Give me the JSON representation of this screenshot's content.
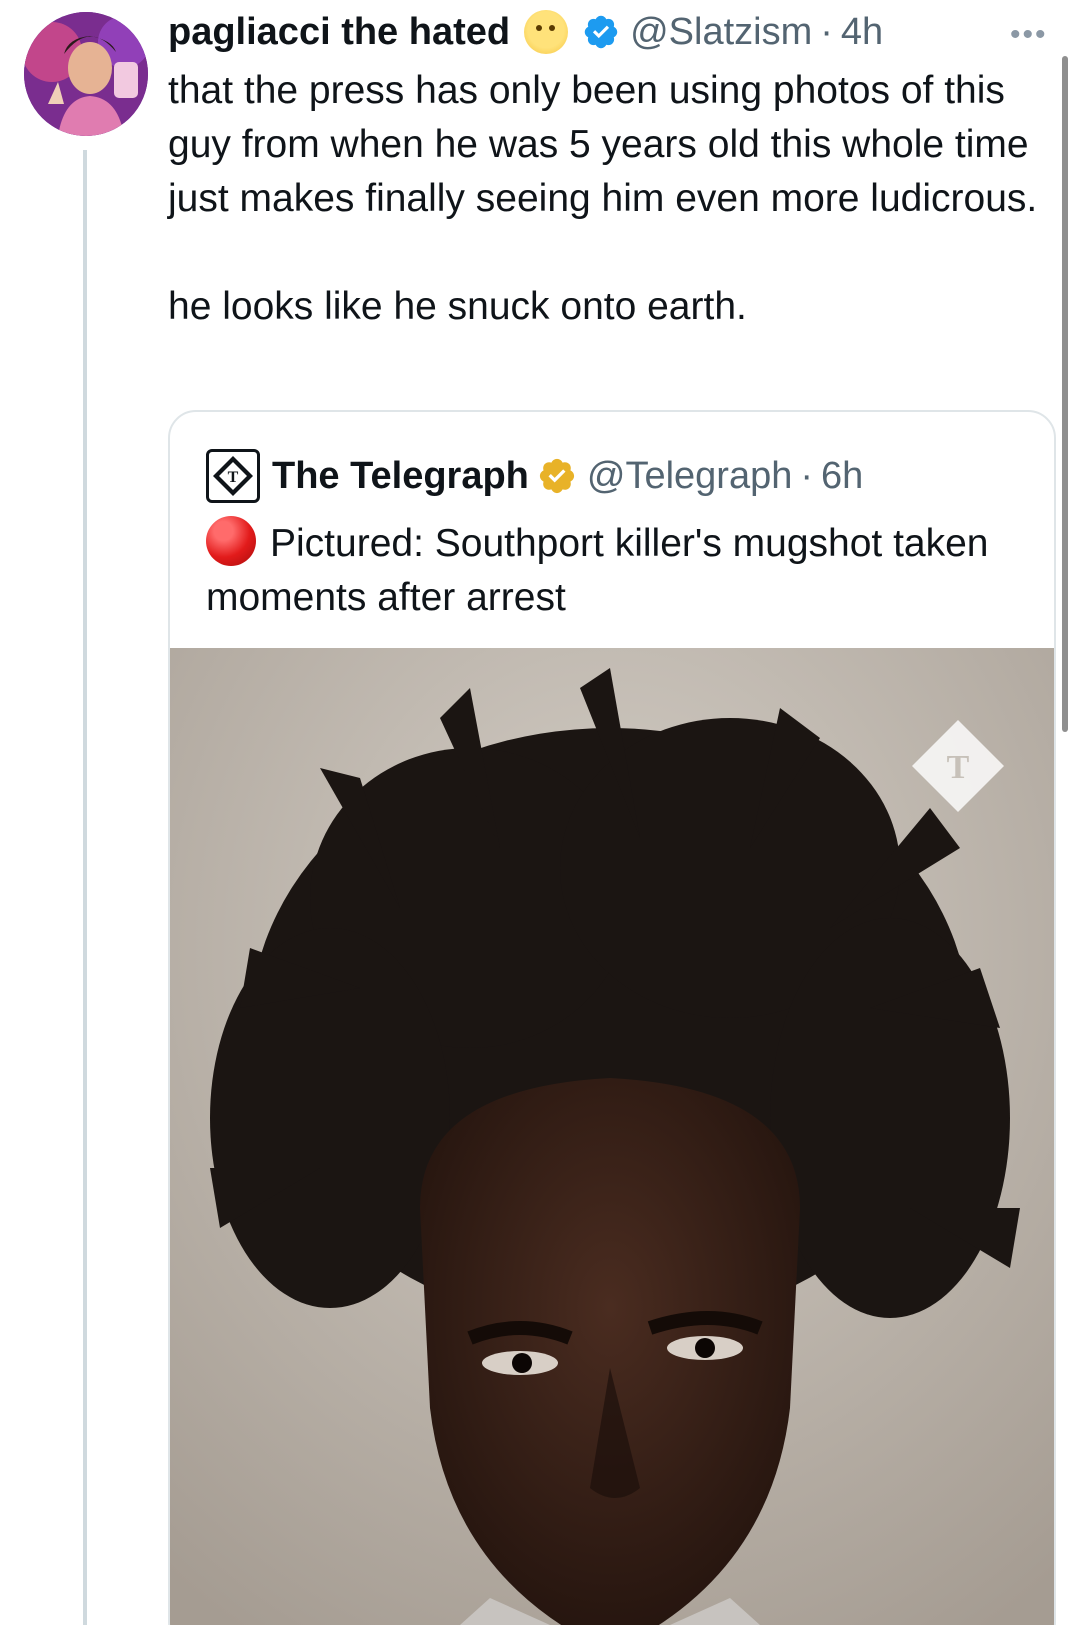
{
  "tweet": {
    "author": {
      "display_name": "pagliacci the hated",
      "emoji_icon": "face-emoji",
      "handle": "@Slatzism",
      "time": "4h"
    },
    "more_label": "•••",
    "text_paragraph_1": "that the press has only been using photos of this guy from when he was 5 years old this whole time just makes finally seeing him even more ludicrous.",
    "text_paragraph_2": "he looks like he snuck onto earth."
  },
  "quote": {
    "author": {
      "display_name": "The Telegraph",
      "handle": "@Telegraph",
      "time": "6h",
      "badge_color": "#e8b228"
    },
    "text": "Pictured: Southport killer's mugshot taken moments after arrest",
    "status_icon": "red-circle-icon",
    "watermark": "T"
  },
  "colors": {
    "verified_blue": "#1d9bf0",
    "muted_text": "#536471",
    "border": "#dfe5e8"
  }
}
